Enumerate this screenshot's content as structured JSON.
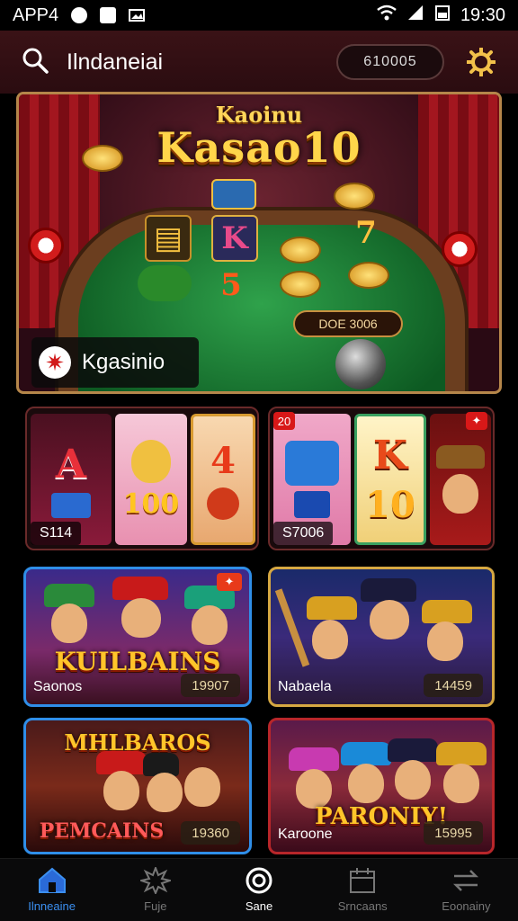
{
  "status_bar": {
    "left_text": "APP4",
    "time": "19:30"
  },
  "header": {
    "title": "Ilndaneiai",
    "balance": "610005"
  },
  "hero": {
    "title_small": "Kaoinu",
    "title": "Kasao10",
    "jackpot": "DOE 3006",
    "label": "Kgasinio",
    "tiles": [
      "7",
      "5"
    ]
  },
  "slot_cards": [
    {
      "caption": "S114",
      "symbols": [
        "A",
        "100",
        "4"
      ]
    },
    {
      "caption": "S7006",
      "badge": "20",
      "symbols": [
        "K",
        "10"
      ]
    }
  ],
  "promo_cards": [
    {
      "title": "KUILBAINS",
      "name": "Saonos",
      "value": "19907"
    },
    {
      "title": "",
      "name": "Nabaela",
      "value": "14459"
    },
    {
      "title_top": "MHLBAROS",
      "title": "PEMCAINS",
      "name": "",
      "value": "19360"
    },
    {
      "title": "PARONIY!",
      "name": "Karoone",
      "value": "15995"
    }
  ],
  "bottom_nav": [
    {
      "label": "Ilnneaine",
      "icon": "home-icon"
    },
    {
      "label": "Fuje",
      "icon": "starburst-icon"
    },
    {
      "label": "Sane",
      "icon": "target-icon"
    },
    {
      "label": "Srncaans",
      "icon": "calendar-icon"
    },
    {
      "label": "Eoonainy",
      "icon": "swap-icon"
    }
  ],
  "colors": {
    "accent": "#3b8ff0",
    "gold": "#ffd54a",
    "header_bg": "#3a1216"
  }
}
